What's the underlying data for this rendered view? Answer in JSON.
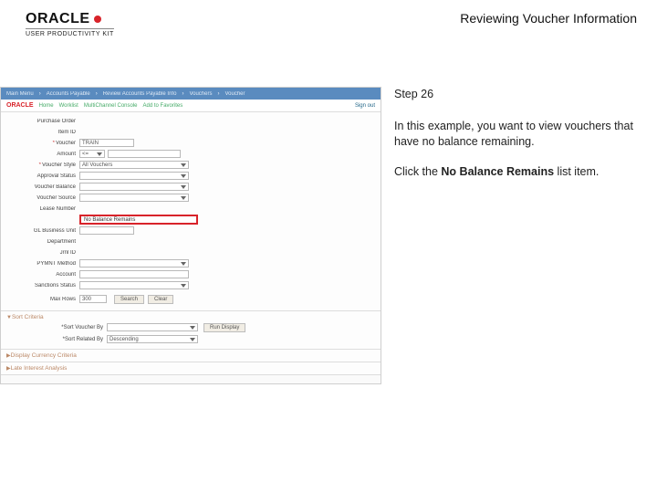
{
  "brand": {
    "name": "ORACLE",
    "subtitle": "USER PRODUCTIVITY KIT"
  },
  "page_title": "Reviewing Voucher Information",
  "instruction": {
    "step": "Step 26",
    "body": "In this example, you want to view vouchers that have no balance remaining.",
    "action_prefix": "Click the ",
    "action_bold": "No Balance Remains",
    "action_suffix": " list item."
  },
  "shot": {
    "breadcrumb": [
      "Main Menu",
      "Accounts Payable",
      "Review Accounts Payable Info",
      "Vouchers",
      "Voucher"
    ],
    "orabar": {
      "brand": "ORACLE",
      "links": [
        "Home",
        "Worklist",
        "MultiChannel Console",
        "Add to Favorites"
      ],
      "signout": "Sign out"
    },
    "fields": {
      "purchase_order": {
        "label": "Purchase Order"
      },
      "item_id": {
        "label": "Item ID"
      },
      "voucher": {
        "label": "Voucher",
        "value": "TRAIN"
      },
      "amount": {
        "label": "Amount",
        "select": "<=",
        "value": ""
      },
      "voucher_style": {
        "label": "Voucher Style",
        "value": "All Vouchers"
      },
      "approval_status": {
        "label": "Approval Status"
      },
      "voucher_balance": {
        "label": "Voucher Balance"
      },
      "voucher_source": {
        "label": "Voucher Source"
      },
      "lease_number": {
        "label": "Lease Number"
      },
      "highlight": {
        "value": "No Balance Remains"
      },
      "gl_business_unit": {
        "label": "GL Business Unit"
      },
      "department": {
        "label": "Department"
      },
      "jrnl_id": {
        "label": "Jrnl ID"
      },
      "pymnt_method": {
        "label": "PYMNT Method"
      },
      "account": {
        "label": "Account"
      },
      "sanctions_status": {
        "label": "Sanctions Status"
      },
      "max_rows": {
        "label": "Max Rows",
        "value": "300"
      }
    },
    "buttons": {
      "search": "Search",
      "clear": "Clear"
    },
    "sections": {
      "sort": {
        "title": "Sort Criteria",
        "sort_view_by": {
          "label": "*Sort Voucher By",
          "value": ""
        },
        "sort_related_by": {
          "label": "*Sort Related By",
          "value": "Descending"
        },
        "run": "Run Display"
      },
      "display_currency": {
        "title": "Display Currency Criteria"
      },
      "late_interest": {
        "title": "Late Interest Analysis"
      }
    }
  }
}
